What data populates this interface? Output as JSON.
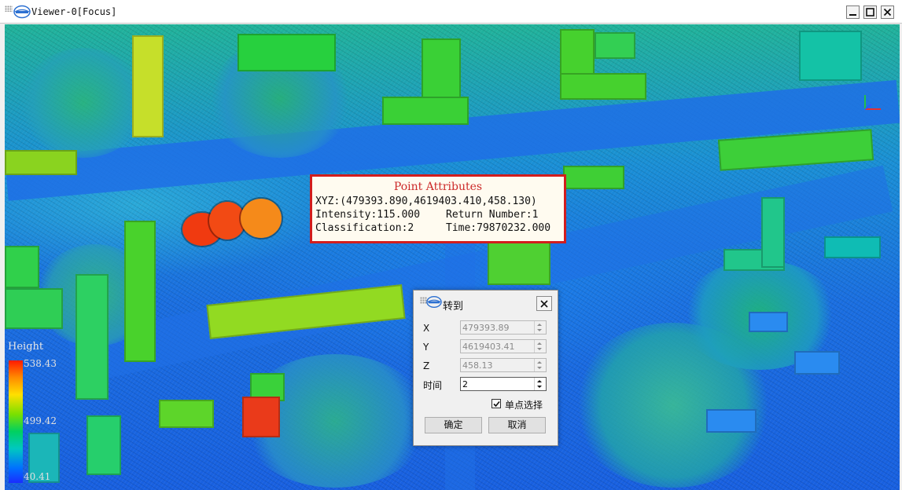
{
  "window": {
    "title": "Viewer-0[Focus]"
  },
  "legend": {
    "title": "Height",
    "max_label": "538.43",
    "mid_label": "499.42",
    "min_label": "40.41"
  },
  "point_attributes": {
    "title": "Point Attributes",
    "xyz": "XYZ:(479393.890,4619403.410,458.130)",
    "intensity": "Intensity:115.000",
    "return_number": "Return Number:1",
    "classification": "Classification:2",
    "time": "Time:79870232.000"
  },
  "goto_dialog": {
    "title": "转到",
    "x_label": "X",
    "x_value": "479393.89",
    "y_label": "Y",
    "y_value": "4619403.41",
    "z_label": "Z",
    "z_value": "458.13",
    "time_label": "时间",
    "time_value": "2",
    "single_point_label": "单点选择",
    "single_point_checked": true,
    "ok_label": "确定",
    "cancel_label": "取消"
  },
  "colors": {
    "attr_border": "#d21d1d",
    "attr_title": "#cc2a2a",
    "low": "#1a2cff",
    "high": "#ff1a00"
  },
  "icons": [
    "app-logo-icon",
    "minimize-icon",
    "maximize-icon",
    "close-icon",
    "axis-gizmo-icon",
    "checkmark-icon"
  ]
}
